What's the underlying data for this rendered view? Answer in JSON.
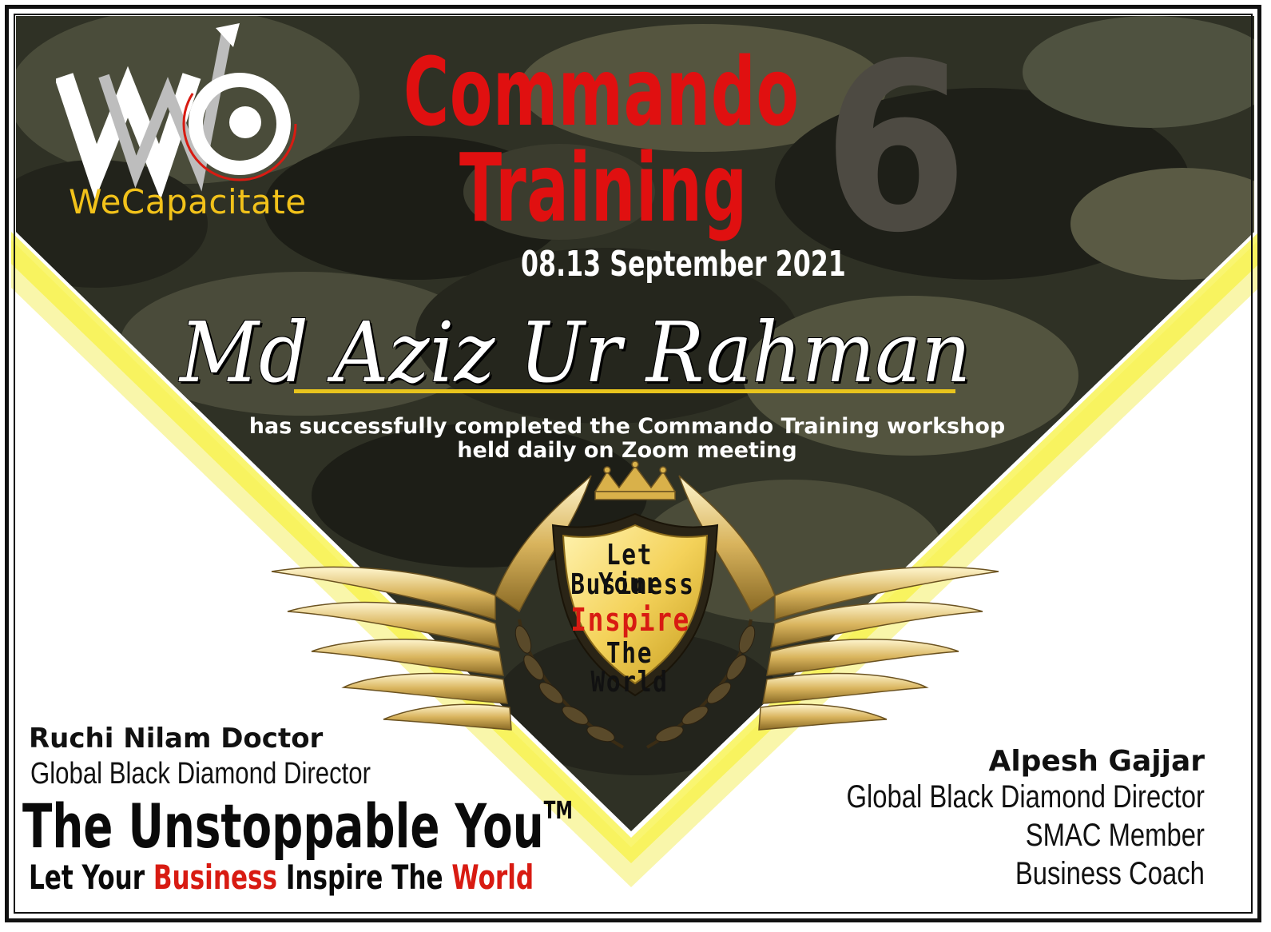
{
  "logo": {
    "brand_text": "WeCapacitate",
    "icon": "wc-logo-arrow-icon"
  },
  "title": {
    "line1": "Commando",
    "line2": "Training",
    "edition": "6",
    "date": "08.13 September 2021"
  },
  "recipient": {
    "name": "Md Aziz Ur Rahman"
  },
  "description": {
    "line1": "has successfully completed the Commando Training workshop",
    "line2": "held daily on Zoom meeting"
  },
  "emblem": {
    "line1": "Let Your",
    "line2": "Business",
    "line3": "Inspire",
    "line4": "The World",
    "icons": [
      "crown-icon",
      "wings-icon",
      "laurel-icon",
      "shield-icon"
    ]
  },
  "signatory_left": {
    "name": "Ruchi Nilam Doctor",
    "role": "Global Black Diamond Director"
  },
  "brand": {
    "name": "The Unstoppable You",
    "tm": "TM",
    "tagline_1": "Let Your ",
    "tagline_2": "Business",
    "tagline_3": " Inspire The ",
    "tagline_4": "World"
  },
  "signatory_right": {
    "name": "Alpesh Gajjar",
    "role": "Global Black Diamond Director",
    "line2": "SMAC Member",
    "line3": "Business Coach"
  },
  "colors": {
    "title_red": "#e01010",
    "accent_gold": "#f2c21a",
    "camo_dark": "#2c2e22",
    "glow_yellow": "#f6f26a"
  }
}
